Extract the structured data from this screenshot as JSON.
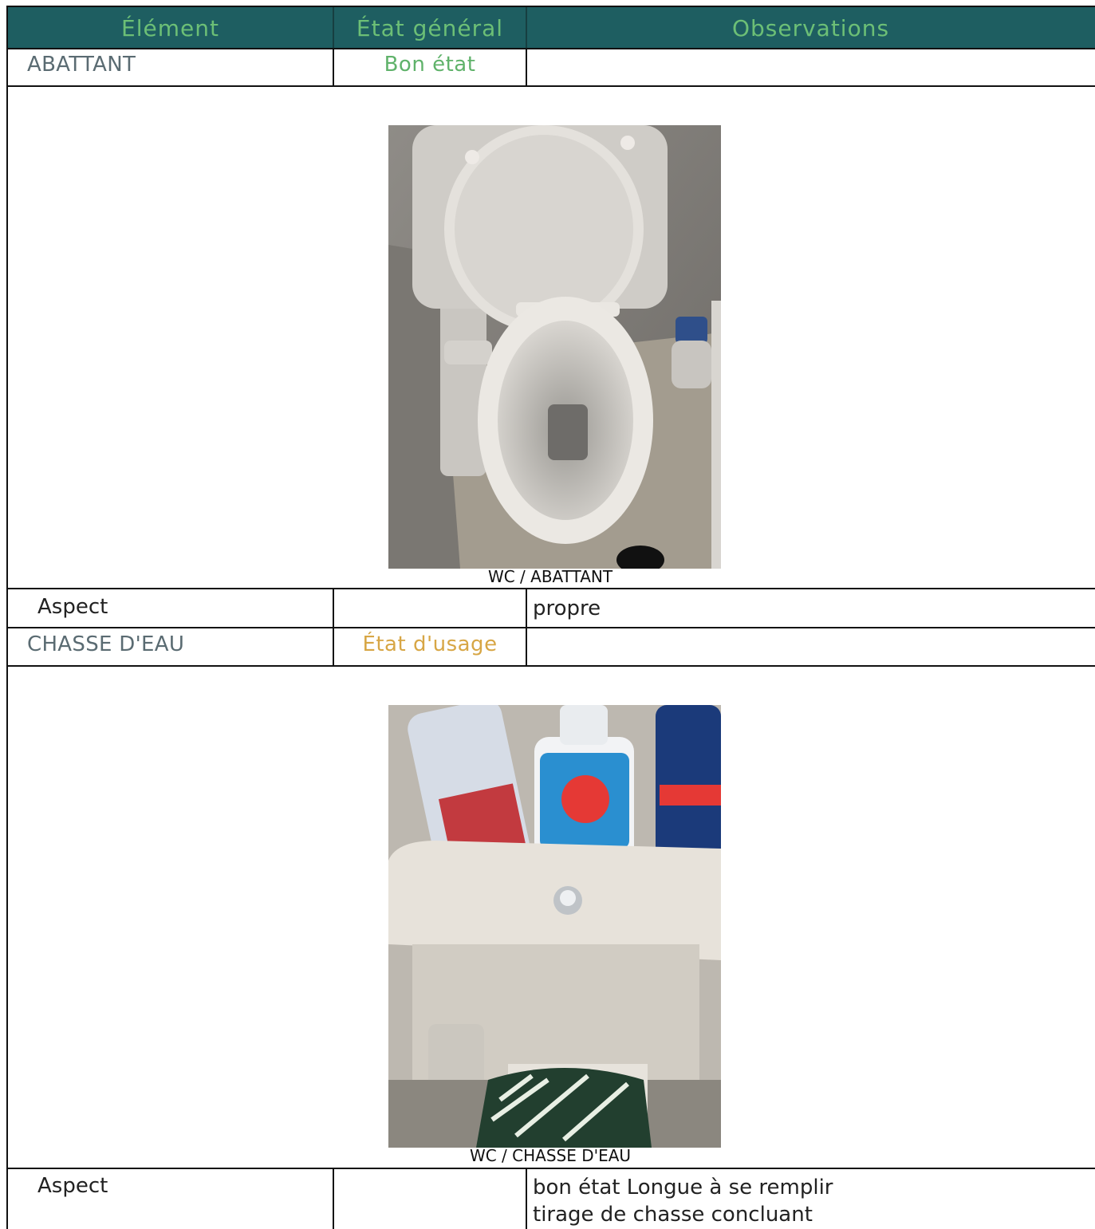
{
  "table": {
    "headers": {
      "element": "Élément",
      "state": "État général",
      "observations": "Observations"
    }
  },
  "rows": [
    {
      "element": "ABATTANT",
      "state": "Bon état",
      "state_color": "#5fb26a",
      "photo_caption": "WC / ABATTANT",
      "aspect_label": "Aspect",
      "aspect_observation": "propre"
    },
    {
      "element": "CHASSE D'EAU",
      "state": "État d'usage",
      "state_color": "#d7a645",
      "photo_caption": "WC / CHASSE D'EAU",
      "aspect_label": "Aspect",
      "aspect_observation_line1": "bon état Longue à se remplir",
      "aspect_observation_line2": "tirage de chasse concluant"
    }
  ],
  "colors": {
    "header_bg": "#1e5e61",
    "header_text": "#6cbf76"
  }
}
